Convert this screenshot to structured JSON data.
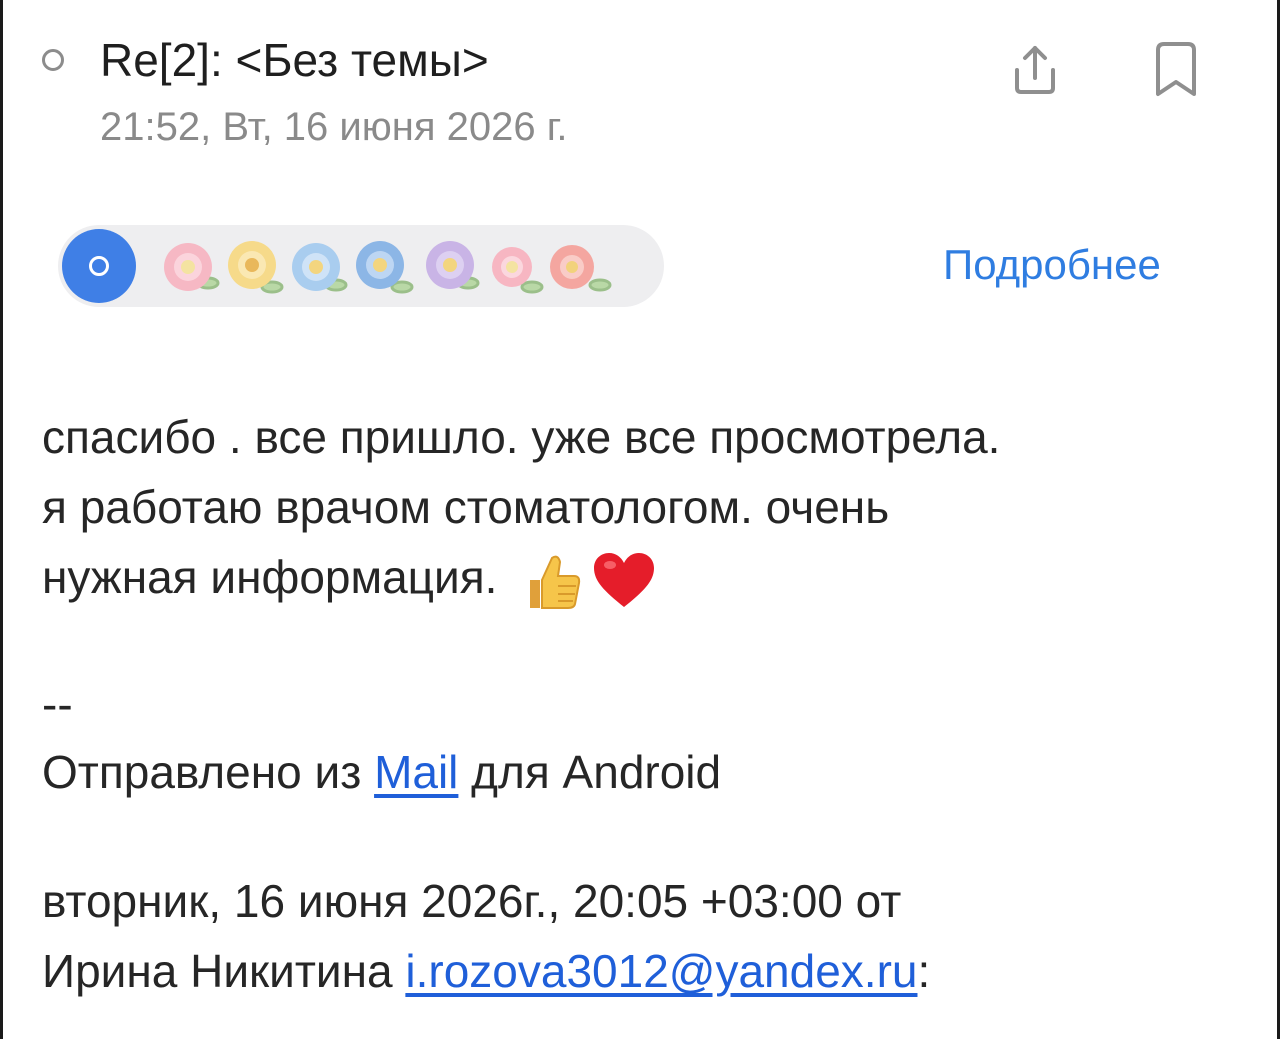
{
  "message": {
    "subject": "Re[2]: <Без темы>",
    "date": "21:52, Вт, 16 июня 2026 г."
  },
  "actions": {
    "details_label": "Подробнее"
  },
  "icons": {
    "share": "share-icon",
    "bookmark": "bookmark-icon",
    "unread": "unread-indicator-icon",
    "avatar": "avatar-icon"
  },
  "body": {
    "line1": "спасибо . все пришло. уже все просмотрела.",
    "line2": "я работаю врачом стоматологом. очень",
    "line3": "нужная информация.",
    "emojis": [
      "thumbs-up",
      "red-heart"
    ]
  },
  "signature": {
    "separator": "--",
    "prefix": "Отправлено из ",
    "link_text": "Mail",
    "suffix": " для Android"
  },
  "quote": {
    "line1": "вторник, 16 июня 2026г., 20:05 +03:00 от",
    "name": "Ирина Никитина ",
    "email": "i.rozova3012@yandex.ru",
    "colon": ":"
  },
  "colors": {
    "accent": "#2f7de1",
    "link": "#1f5fd9",
    "avatar": "#3f7fe6",
    "chip_bg": "#eeeef0",
    "muted": "#8a8a8a"
  }
}
